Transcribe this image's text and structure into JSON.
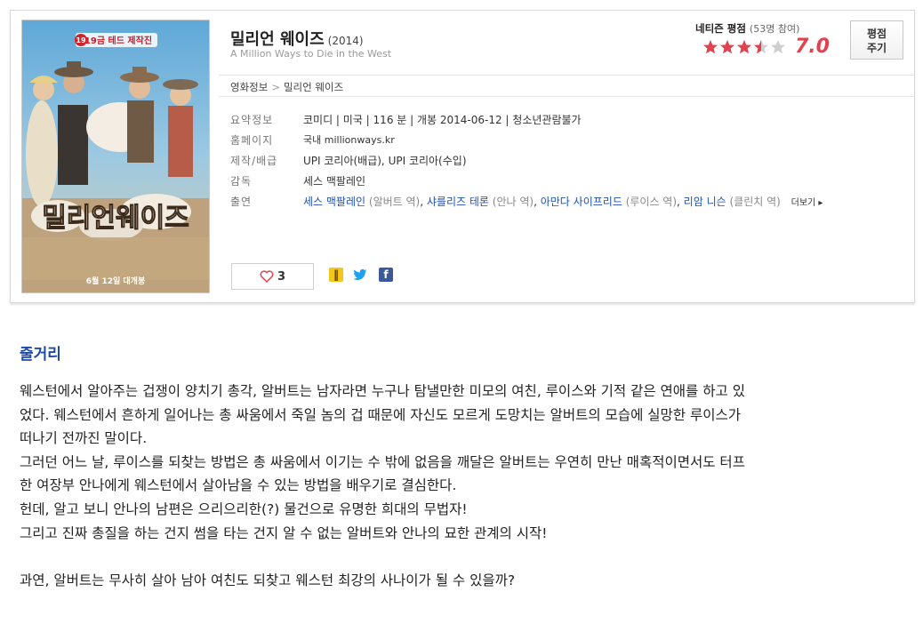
{
  "movie": {
    "title": "밀리언 웨이즈",
    "year": "(2014)",
    "original_title": "A Million Ways to Die in the West",
    "poster": {
      "badge": "19금 테드 제작진",
      "title_text": "밀리언웨이즈",
      "date_text": "6월 12일 대개봉"
    }
  },
  "rating": {
    "label": "네티즌 평점",
    "count": "(53명 참여)",
    "score": "7.0",
    "score_fraction": 0.7,
    "rate_button_line1": "평점",
    "rate_button_line2": "주기",
    "star_color": "#e2424f"
  },
  "breadcrumb": {
    "root": "영화정보",
    "sep": ">",
    "current": "밀리언 웨이즈"
  },
  "info": {
    "summary_label": "요약정보",
    "summary_value": "코미디 | 미국 | 116 분 | 개봉 2014-06-12 | 청소년관람불가",
    "homepage_label": "홈페이지",
    "homepage_value": "국내 millionways.kr",
    "distribution_label": "제작/배급",
    "distribution_value": "UPI 코리아(배급), UPI 코리아(수입)",
    "director_label": "감독",
    "director_value": "세스 맥팔레인",
    "cast_label": "출연",
    "cast": [
      {
        "name": "세스 맥팔레인",
        "role": "(알버트 역)"
      },
      {
        "name": "샤를리즈 테론",
        "role": "(안나 역)"
      },
      {
        "name": "아만다 사이프리드",
        "role": "(루이스 역)"
      },
      {
        "name": "리암 니슨",
        "role": "(클린치 역)"
      }
    ],
    "more_label": "더보기 ▸"
  },
  "like": {
    "count": "3"
  },
  "social": {
    "icons": [
      "kakao-icon",
      "twitter-icon",
      "facebook-icon"
    ]
  },
  "synopsis": {
    "title": "줄거리",
    "lines": [
      "웨스턴에서 알아주는 겁쟁이 양치기 총각, 알버트는 남자라면 누구나 탐낼만한 미모의 여친, 루이스와 기적 같은 연애를 하고 있",
      "었다. 웨스턴에서 흔하게 일어나는 총 싸움에서 죽일 놈의 겁 때문에 자신도 모르게 도망치는 알버트의 모습에 실망한 루이스가",
      "떠나기 전까진 말이다.",
      "그러던 어느 날, 루이스를 되찾는 방법은 총 싸움에서 이기는 수 밖에 없음을 깨달은 알버트는 우연히 만난 매혹적이면서도 터프",
      "한 여장부 안나에게 웨스턴에서 살아남을 수 있는 방법을 배우기로 결심한다.",
      "헌데, 알고 보니 안나의 남편은 으리으리한(?) 물건으로 유명한 희대의 무법자!",
      "그리고 진짜 총질을 하는 건지 썸을 타는 건지 알 수 없는 알버트와 안나의 묘한 관계의 시작!",
      "",
      "과연, 알버트는 무사히 살아 남아 여친도 되찾고 웨스턴 최강의 사나이가 될 수 있을까?"
    ]
  }
}
